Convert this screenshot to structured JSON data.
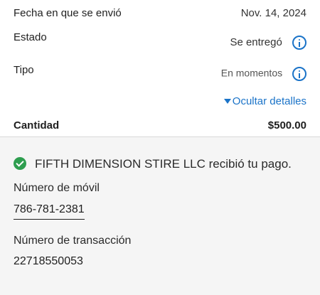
{
  "details": {
    "sent_date_label": "Fecha en que se envió",
    "sent_date_value": "Nov. 14, 2024",
    "status_label": "Estado",
    "status_value": "Se entregó",
    "type_label": "Tipo",
    "type_value": "En momentos",
    "toggle_label": "Ocultar detalles",
    "amount_label": "Cantidad",
    "amount_value": "$500.00"
  },
  "receipt": {
    "message": "FIFTH DIMENSION STIRE LLC recibió tu pago.",
    "mobile_label": "Número de móvil",
    "mobile_value": "786-781-2381",
    "transaction_label": "Número de transacción",
    "transaction_value": "22718550053"
  },
  "colors": {
    "link": "#1a73c8",
    "success": "#2e9e4f"
  },
  "icons": [
    "info-icon",
    "triangle-down-icon",
    "check-circle-icon"
  ]
}
